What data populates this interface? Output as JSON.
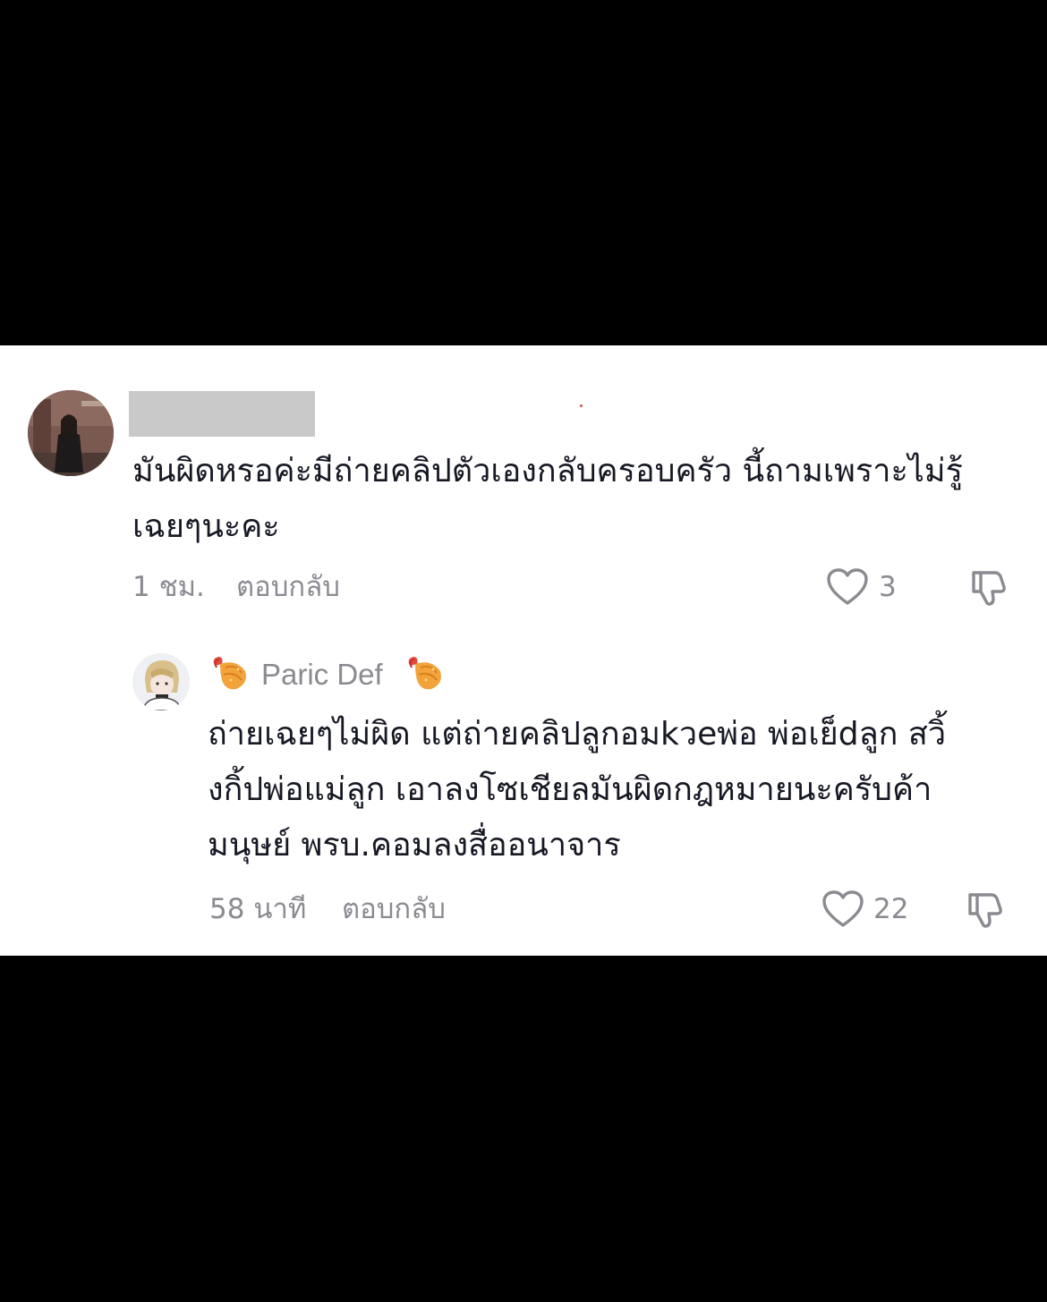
{
  "comment": {
    "username_redacted": true,
    "text": "มันผิดหรอค่ะมีถ่ายคลิปตัวเองกลับครอบครัว นี้ถามเพราะไม่รู้\nเฉยๆนะคะ",
    "time": "1 ชม.",
    "reply_label": "ตอบกลับ",
    "likes": "3",
    "icons": [
      "heart-outline-icon",
      "thumbs-down-icon"
    ]
  },
  "reply": {
    "author": "Paric Def",
    "author_decoration_icon": "shrimp-tempura-icon",
    "text": "ถ่ายเฉยๆไม่ผิด แต่ถ่ายคลิปลูกอมkวeพ่อ พ่อเย็dลูก สวิ้\nงกิ้ปพ่อแม่ลูก เอาลงโซเชียลมันผิดกฎหมายนะครับค้า\nมนุษย์ พรบ.คอมลงสื่ออนาจาร",
    "time": "58 นาที",
    "reply_label": "ตอบกลับ",
    "likes": "22",
    "icons": [
      "heart-outline-icon",
      "thumbs-down-icon"
    ]
  },
  "colors": {
    "background": "#000000",
    "panel": "#ffffff",
    "text_primary": "#161823",
    "text_secondary": "#8a8b91",
    "redaction": "#c9c9c9"
  }
}
